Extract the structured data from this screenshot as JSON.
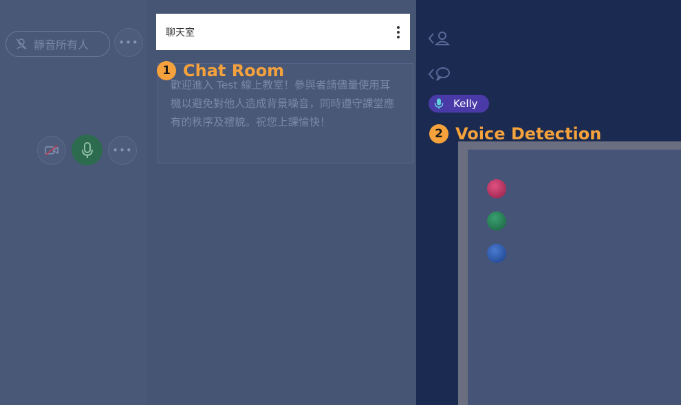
{
  "participants": {
    "mute_all_label": "靜音所有人",
    "more_label": "•••"
  },
  "chat": {
    "title": "聊天室",
    "welcome_message": "歡迎進入 Test 線上教室！參與者請儘量使用耳機以避免對他人造成背景噪音，同時遵守課堂應有的秩序及禮貌。祝您上課愉快！"
  },
  "voice": {
    "speaker_name": "Kelly"
  },
  "annotations": [
    {
      "number": "1",
      "label": "Chat Room"
    },
    {
      "number": "2",
      "label": "Voice Detection"
    }
  ],
  "colors": {
    "accent": "#f6a23c",
    "voice_pill": "#4a3aa8",
    "marker_red": "#c03060",
    "marker_green": "#2a8a5a",
    "marker_blue": "#2a5ab0"
  }
}
